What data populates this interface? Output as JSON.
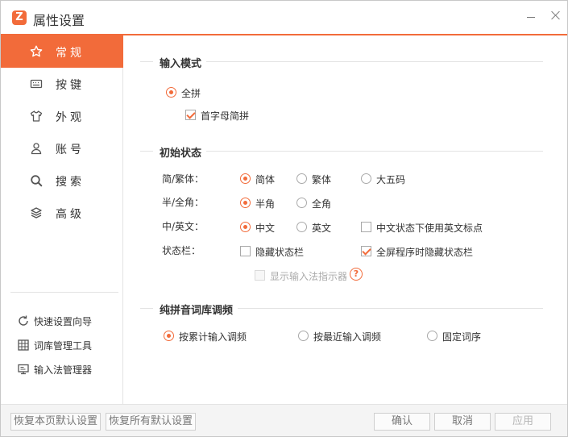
{
  "window": {
    "title": "属性设置",
    "accent": "#f26b3a"
  },
  "sidebar": {
    "nav": [
      {
        "label": "常规",
        "icon": "star-icon",
        "active": true
      },
      {
        "label": "按键",
        "icon": "keyboard-icon",
        "active": false
      },
      {
        "label": "外观",
        "icon": "shirt-icon",
        "active": false
      },
      {
        "label": "账号",
        "icon": "user-icon",
        "active": false
      },
      {
        "label": "搜索",
        "icon": "search-icon",
        "active": false
      },
      {
        "label": "高级",
        "icon": "layers-icon",
        "active": false
      }
    ],
    "tools": [
      {
        "label": "快速设置向导",
        "icon": "refresh-icon"
      },
      {
        "label": "词库管理工具",
        "icon": "grid-icon"
      },
      {
        "label": "输入法管理器",
        "icon": "monitor-icon"
      }
    ]
  },
  "input_mode": {
    "title": "输入模式",
    "quanpin": {
      "label": "全拼",
      "selected": true
    },
    "initials": {
      "label": "首字母简拼",
      "checked": true
    }
  },
  "initial_state": {
    "title": "初始状态",
    "rows": [
      {
        "label": "简/繁体：",
        "options": [
          "简体",
          "繁体",
          "大五码"
        ],
        "selected": 0
      },
      {
        "label": "半/全角：",
        "options": [
          "半角",
          "全角"
        ],
        "selected": 0
      },
      {
        "label": "中/英文：",
        "options": [
          "中文",
          "英文"
        ],
        "selected": 0,
        "extra": {
          "label": "中文状态下使用英文标点",
          "checked": false
        }
      },
      {
        "label": "状态栏：",
        "hide_statusbar": {
          "label": "隐藏状态栏",
          "checked": false
        },
        "fullscreen_hide": {
          "label": "全屏程序时隐藏状态栏",
          "checked": true
        }
      }
    ],
    "indicator": {
      "label": "显示输入法指示器",
      "checked": false,
      "disabled": true
    }
  },
  "pinyin_tuning": {
    "title": "纯拼音词库调频",
    "options": [
      "按累计输入调频",
      "按最近输入调频",
      "固定词序"
    ],
    "selected": 0
  },
  "footer": {
    "reset_page": "恢复本页默认设置",
    "reset_all": "恢复所有默认设置",
    "ok": "确认",
    "cancel": "取消",
    "apply": "应用"
  }
}
